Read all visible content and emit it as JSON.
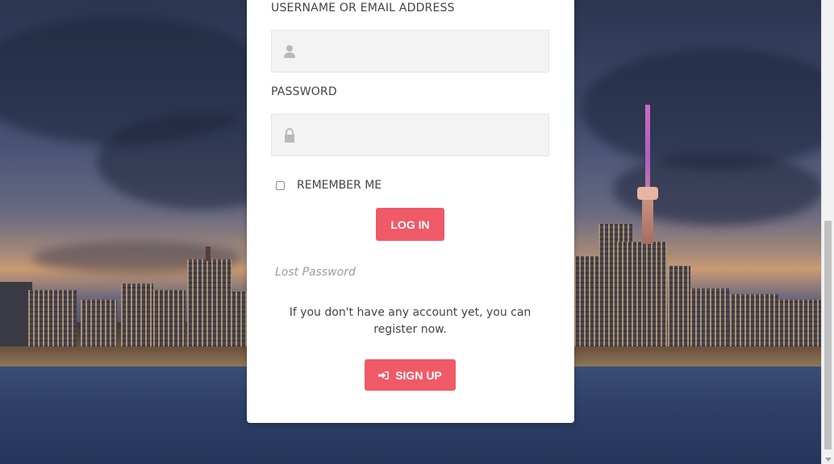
{
  "form": {
    "username_label": "USERNAME OR EMAIL ADDRESS",
    "username_value": "",
    "password_label": "PASSWORD",
    "password_value": "",
    "remember_label": "REMEMBER ME",
    "remember_checked": false,
    "login_label": "LOG IN",
    "lost_password_label": "Lost Password",
    "register_text": "If you don't have any account yet, you can register now.",
    "signup_label": "SIGN UP"
  },
  "icons": {
    "username_field": "user-icon",
    "password_field": "lock-icon",
    "signup_button": "sign-in-icon"
  },
  "colors": {
    "accent": "#f05a67",
    "field_bg": "#f3f3f3",
    "card_bg": "#ffffff"
  }
}
